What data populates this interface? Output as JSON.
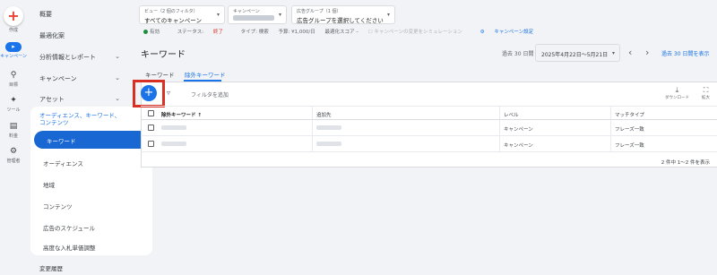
{
  "rail": {
    "create": "作成",
    "campaigns": "キャンペーン",
    "goals": "目標",
    "tools": "ツール",
    "billing": "料金",
    "admin": "管理者"
  },
  "nav": {
    "overview": "概要",
    "recommendations": "最適化案",
    "insights": "分析情報とレポート",
    "campaigns": "キャンペーン",
    "assets": "アセット",
    "audience_section": "オーディエンス、キーワード、コンテンツ",
    "sub_items": [
      "キーワード",
      "オーディエンス",
      "地域",
      "コンテンツ",
      "広告のスケジュール",
      "高度な入札単価調整"
    ],
    "change_history": "変更履歴"
  },
  "filters": {
    "view_caption": "ビュー（2 個のフィルタ）",
    "view_value": "すべてのキャンペーン",
    "campaign_caption": "キャンペーン",
    "adgroup_caption": "広告グループ（1 個）",
    "adgroup_value": "広告グループを選択してください"
  },
  "status": {
    "enabled": "有効",
    "status_label": "ステータス:",
    "status_value": "終了",
    "type": "タイプ: 検索",
    "budget": "予算: ¥1,000/日",
    "opt_score": "最適化スコア –",
    "simulate": "キャンペーンの変更をシミュレーション",
    "settings": "キャンペーン設定"
  },
  "header": {
    "title": "キーワード",
    "period_label": "過去 30 日間",
    "date_range": "2025年4月22日～5月21日",
    "compare": "過去 30 日間を表示"
  },
  "tabs": [
    "キーワード",
    "除外キーワード"
  ],
  "toolbar": {
    "add_filter": "フィルタを追加",
    "download": "ダウンロード",
    "expand": "拡大"
  },
  "table": {
    "columns": [
      "除外キーワード",
      "追加先",
      "レベル",
      "マッチタイプ"
    ],
    "rows": [
      {
        "level": "キャンペーン",
        "match": "フレーズ一致"
      },
      {
        "level": "キャンペーン",
        "match": "フレーズ一致"
      }
    ],
    "pagination": "2 件中 1～2 件を表示"
  },
  "colors": {
    "accent": "#1a73e8",
    "highlight": "#d93025"
  }
}
